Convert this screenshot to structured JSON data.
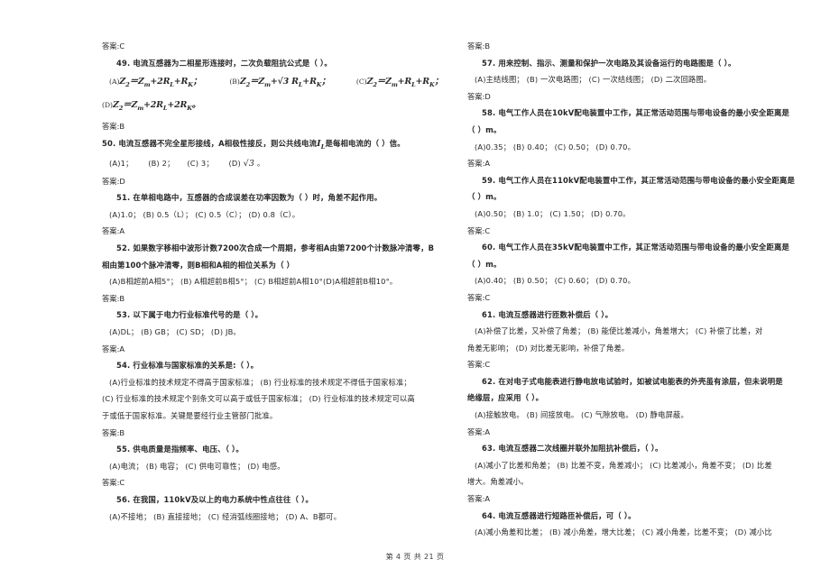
{
  "document": {
    "footer": "第 4 页   共 21 页"
  },
  "left_column": {
    "blocks": [
      {
        "type": "answer",
        "text": "答案:C"
      },
      {
        "type": "question",
        "text": "49. 电流互感器为二相星形连接时，二次负载阻抗公式是（   ）。"
      },
      {
        "type": "formula_row",
        "items": [
          {
            "label": "(A)",
            "formula": "Z₂＝Z_m+2R_L+R_K；"
          },
          {
            "label": "(B)",
            "formula": "Z₂＝Z_m+√3 R_L+R_K；"
          },
          {
            "label": "(C)",
            "formula": "Z₂＝Z_m+R_L+R_K；"
          }
        ]
      },
      {
        "type": "formula_row2",
        "items": [
          {
            "label": "(D)",
            "formula": "Z₂＝Z_m+2R_L+2R_K。"
          }
        ]
      },
      {
        "type": "answer",
        "text": "答案:B"
      },
      {
        "type": "question_noindent",
        "text": "50. 电流互感器不完全星形接线，A相极性接反，则公共线电流 I_L 是每相电流的（   ）信。"
      },
      {
        "type": "options",
        "text": "(A)1；      (B) 2；     (C) 3；      (D) √3 。"
      },
      {
        "type": "answer",
        "text": "答案:D"
      },
      {
        "type": "question",
        "text": "51. 在单相电路中，互感器的合成误差在功率因数为（   ）时，角差不起作用。"
      },
      {
        "type": "options",
        "text": "(A)1.0；     (B) 0.5（L）；      (C) 0.5（C）；      (D) 0.8（C）。"
      },
      {
        "type": "answer",
        "text": "答案:A"
      },
      {
        "type": "question",
        "text": "52. 如果数字移相中波形计数7200次合成一个周期，参考相A由第7200个计数脉冲清零，B"
      },
      {
        "type": "question_cont",
        "text": "相由第100个脉冲清零，则B相和A相的相位关系为（   ）"
      },
      {
        "type": "options",
        "text": "(A)B相超前A相5°；      (B) A相超前B相5°；      (C) B相超前A相10°(D)A相超前B相10°。"
      },
      {
        "type": "answer",
        "text": "答案:B"
      },
      {
        "type": "question",
        "text": "53. 以下属于电力行业标准代号的是（   ）。"
      },
      {
        "type": "options",
        "text": "(A)DL；      (B) GB；      (C) SD；      (D) JB。"
      },
      {
        "type": "answer",
        "text": "答案:A"
      },
      {
        "type": "question",
        "text": "54. 行业标准与国家标准的关系是:（   ）。"
      },
      {
        "type": "options",
        "text": "(A)行业标准的技术规定不得高于国家标准；      (B) 行业标准的技术规定不得低于国家标准；"
      },
      {
        "type": "options_cont",
        "text": "(C) 行业标准的技术规定个别条文可以高于或低于国家标准；      (D) 行业标准的技术规定可以高"
      },
      {
        "type": "options_cont",
        "text": "于或低于国家标准。关键是要经行业主管部门批准。"
      },
      {
        "type": "answer",
        "text": "答案:B"
      },
      {
        "type": "question",
        "text": "55. 供电质量是指频率、电压、（   ）。"
      },
      {
        "type": "options",
        "text": "(A)电流；      (B) 电容；      (C) 供电可靠性；      (D) 电感。"
      },
      {
        "type": "answer",
        "text": "答案:C"
      },
      {
        "type": "question",
        "text": "56. 在我国，110kV及以上的电力系统中性点往往（   ）。"
      },
      {
        "type": "options",
        "text": "(A)不接地；      (B) 直接接地；      (C) 经消弧线圈接地；      (D) A、B都可。"
      }
    ]
  },
  "right_column": {
    "blocks": [
      {
        "type": "answer",
        "text": "答案:B"
      },
      {
        "type": "question",
        "text": "57. 用来控制、指示、测量和保护一次电路及其设备运行的电路图是（   ）。"
      },
      {
        "type": "options",
        "text": "(A)主结线图；      (B) 一次电路图；      (C) 一次结线图；      (D) 二次回路图。"
      },
      {
        "type": "answer",
        "text": "答案:D"
      },
      {
        "type": "question",
        "text": "58. 电气工作人员在10kV配电装置中工作，其正常活动范围与带电设备的最小安全距离是"
      },
      {
        "type": "question_cont",
        "text": "（   ）m。"
      },
      {
        "type": "options",
        "text": "(A)0.35；      (B) 0.40；      (C) 0.50；      (D) 0.70。"
      },
      {
        "type": "answer",
        "text": "答案:A"
      },
      {
        "type": "question",
        "text": "59. 电气工作人员在110kV配电装置中工作，其正常活动范围与带电设备的最小安全距离是"
      },
      {
        "type": "question_cont",
        "text": "（   ）m。"
      },
      {
        "type": "options",
        "text": "(A)0.50；      (B) 1.0；      (C) 1.50；      (D) 0.70。"
      },
      {
        "type": "answer",
        "text": "答案:C"
      },
      {
        "type": "question",
        "text": "60. 电气工作人员在35kV配电装置中工作，其正常活动范围与带电设备的最小安全距离是"
      },
      {
        "type": "question_cont",
        "text": "（   ）m。"
      },
      {
        "type": "options",
        "text": "(A)0.40；      (B) 0.50；      (C) 0.60；      (D) 0.70。"
      },
      {
        "type": "answer",
        "text": "答案:C"
      },
      {
        "type": "question",
        "text": "61. 电流互感器进行匝数补偿后（   ）。"
      },
      {
        "type": "options",
        "text": "(A)补偿了比差，又补偿了角差；      (B) 能使比差减小，角差增大；      (C) 补偿了比差，对"
      },
      {
        "type": "options_cont",
        "text": "角差无影响；      (D) 对比差无影响，补偿了角差。"
      },
      {
        "type": "answer",
        "text": "答案:C"
      },
      {
        "type": "question",
        "text": "62. 在对电子式电能表进行静电放电试验时，如被试电能表的外壳虽有涂层，但未说明是"
      },
      {
        "type": "question_cont",
        "text": "绝缘层，应采用（   ）。"
      },
      {
        "type": "options",
        "text": "(A)接触放电。      (B) 间接放电。      (C) 气隙放电。      (D) 静电屏蔽。"
      },
      {
        "type": "answer",
        "text": "答案:A"
      },
      {
        "type": "question",
        "text": "63. 电流互感器二次线圈并联外加阻抗补偿后，（   ）。"
      },
      {
        "type": "options",
        "text": "(A)减小了比差和角差；      (B) 比差不变，角差减小；      (C) 比差减小，角差不变；      (D) 比差"
      },
      {
        "type": "options_cont",
        "text": "增大。角差减小。"
      },
      {
        "type": "answer",
        "text": "答案:A"
      },
      {
        "type": "question",
        "text": "64. 电流互感器进行短路匝补偿后，可（   ）。"
      },
      {
        "type": "options",
        "text": "(A)减小角差和比差；      (B) 减小角差，增大比差；      (C) 减小角差，比差不变；      (D) 减小比"
      }
    ]
  }
}
